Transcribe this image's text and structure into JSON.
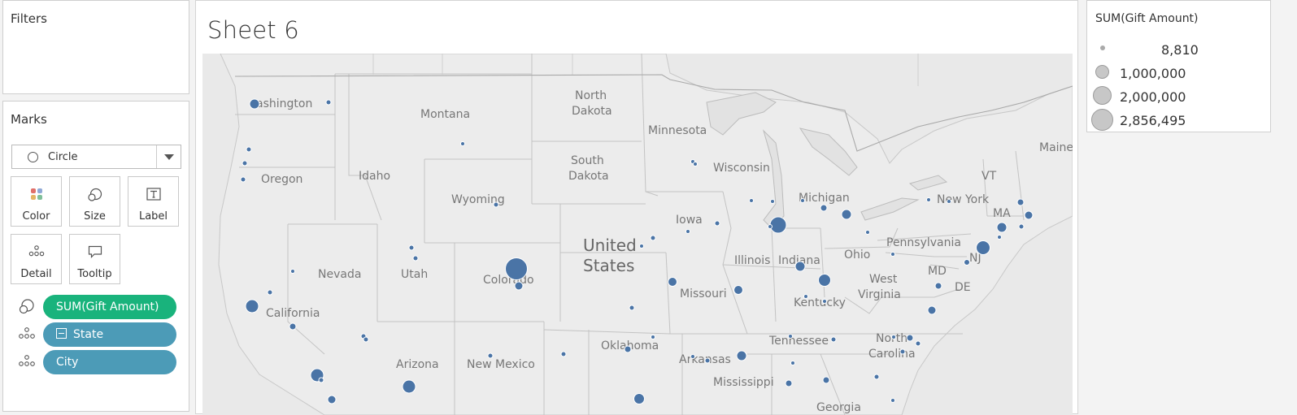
{
  "filters": {
    "title": "Filters"
  },
  "marks": {
    "title": "Marks",
    "mark_type": "Circle",
    "buttons": [
      {
        "label": "Color",
        "icon": "color-icon"
      },
      {
        "label": "Size",
        "icon": "size-icon"
      },
      {
        "label": "Label",
        "icon": "label-icon"
      },
      {
        "label": "Detail",
        "icon": "detail-icon"
      },
      {
        "label": "Tooltip",
        "icon": "tooltip-icon"
      }
    ],
    "pills": [
      {
        "label": "SUM(Gift Amount)",
        "color": "#19b37c",
        "icon": "size-icon"
      },
      {
        "label": "State",
        "color": "#4c9bb7",
        "icon": "detail-icon"
      },
      {
        "label": "City",
        "color": "#4c9bb7",
        "icon": "detail-icon"
      }
    ]
  },
  "sheet": {
    "title": "Sheet 6"
  },
  "map": {
    "labels": [
      "ashington",
      "Montana",
      "North",
      "Dakota",
      "Minnesota",
      "Oregon",
      "Idaho",
      "South",
      "Dakota",
      "Wisconsin",
      "Wyoming",
      "Michigan",
      "Iowa",
      "New York",
      "Nevada",
      "Utah",
      "United",
      "States",
      "Illinois",
      "Indiana",
      "Ohio",
      "Pennsylvania",
      "Colorado",
      "Missouri",
      "West",
      "Virginia",
      "California",
      "Kentucky",
      "MD",
      "DE",
      "NJ",
      "VT",
      "MA",
      "Maine",
      "Tennessee",
      "North",
      "Carolina",
      "Arizona",
      "New Mexico",
      "Oklahoma",
      "Arkansas",
      "Mississippi",
      "Georgia"
    ],
    "mark_color": "#4a74a6"
  },
  "legend": {
    "title": "SUM(Gift Amount)",
    "items": [
      "8,810",
      "1,000,000",
      "2,000,000",
      "2,856,495"
    ]
  }
}
